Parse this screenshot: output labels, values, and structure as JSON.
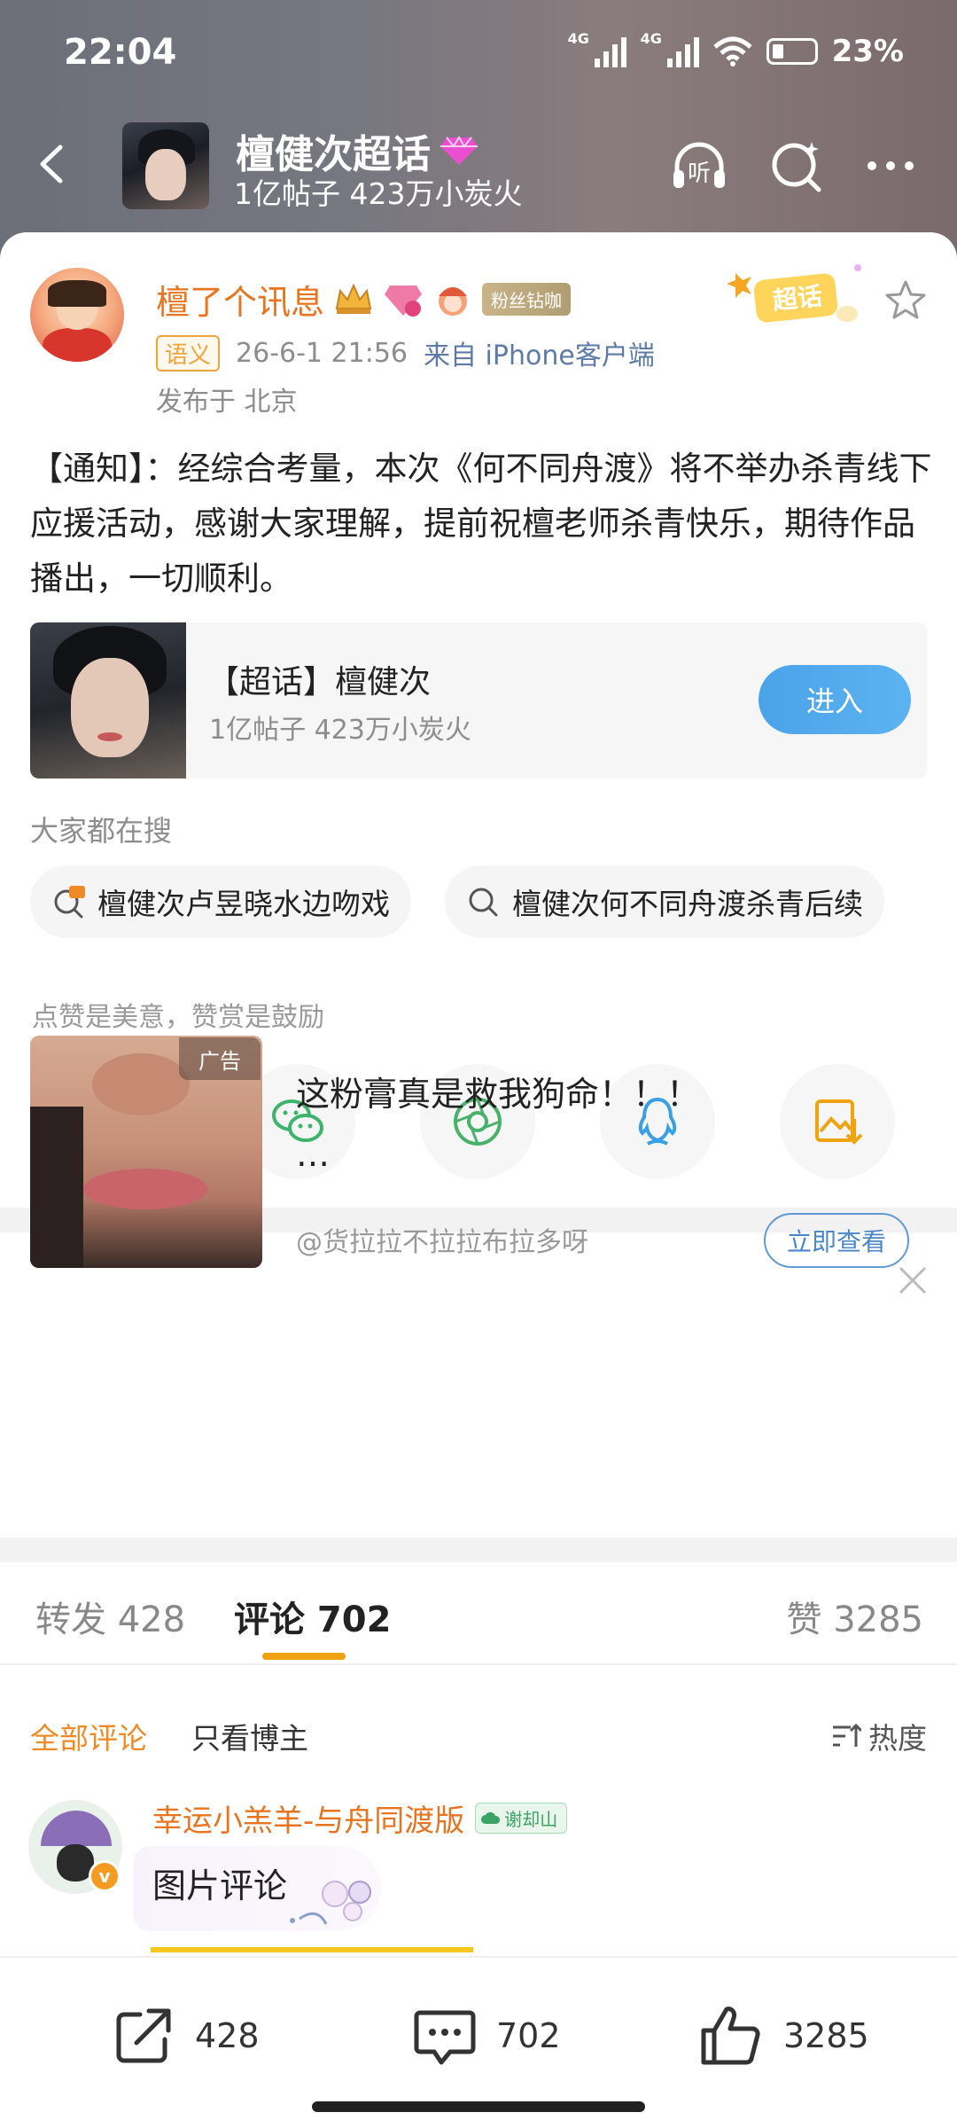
{
  "status_bar": {
    "time": "22:04",
    "network1": "4G",
    "network2": "4G",
    "battery": "23%"
  },
  "topbar": {
    "title": "檀健次超话",
    "subtitle": "1亿帖子 423万小炭火",
    "listen_label": "听"
  },
  "post": {
    "username": "檀了个讯息",
    "fan_badge": "粉丝钻咖",
    "stamp_label": "超话",
    "tag": "语义",
    "time": "26-6-1 21:56",
    "source": "来自 iPhone客户端",
    "location": "发布于 北京",
    "text": "【通知】：经综合考量，本次《何不同舟渡》将不举办杀青线下应援活动，感谢大家理解，提前祝檀老师杀青快乐，期待作品播出，一切顺利。"
  },
  "supertopic_card": {
    "title": "【超话】檀健次",
    "subtitle": "1亿帖子 423万小炭火",
    "button": "进入"
  },
  "searches": {
    "label": "大家都在搜",
    "items": [
      "檀健次卢昱晓水边吻戏",
      "檀健次何不同舟渡杀青后续"
    ]
  },
  "reward": {
    "label": "点赞是美意，赞赏是鼓励"
  },
  "ad": {
    "tag": "广告",
    "title": "这粉膏真是救我狗命！！！",
    "ellipsis": "…",
    "author": "@货拉拉不拉拉布拉多呀",
    "button": "立即查看"
  },
  "tabs": {
    "repost": "转发 428",
    "comments": "评论 702",
    "likes": "赞 3285"
  },
  "filters": {
    "all": "全部评论",
    "op_only": "只看博主",
    "sort": "热度"
  },
  "comment": {
    "username": "幸运小羔羊-与舟同渡版",
    "tag": "谢却山",
    "text": "图片评论"
  },
  "bottom_bar": {
    "repost_count": "428",
    "comment_count": "702",
    "like_count": "3285"
  },
  "colors": {
    "accent_orange": "#e8741f",
    "enter_blue": "#4aa3e8",
    "tab_underline": "#f0a312"
  }
}
